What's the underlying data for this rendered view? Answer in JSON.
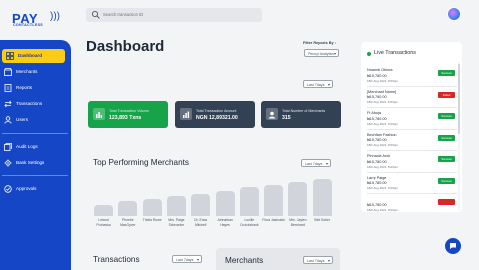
{
  "brand": {
    "name": "PAY",
    "tagline": "CONTACTLESS"
  },
  "search": {
    "placeholder": "Search transaction ID"
  },
  "sidebar": {
    "items": [
      {
        "label": "Dashboard",
        "icon": "dashboard-icon",
        "active": true
      },
      {
        "label": "Merchants",
        "icon": "merchants-icon"
      },
      {
        "label": "Reports",
        "icon": "reports-icon"
      },
      {
        "label": "Transactions",
        "icon": "transactions-icon"
      },
      {
        "label": "Users",
        "icon": "users-icon"
      },
      {
        "label": "Audit Logs",
        "icon": "audit-logs-icon"
      },
      {
        "label": "Bank Settings",
        "icon": "bank-settings-icon"
      },
      {
        "label": "Approvals",
        "icon": "approvals-icon"
      }
    ]
  },
  "main": {
    "title": "Dashboard",
    "filter": {
      "label": "Filter Reports By :",
      "value": "Pencyl Analytics"
    },
    "period_dropdown": "Last 7days",
    "stats": [
      {
        "label": "Total Transaction Volume",
        "value": "123,893 Txns",
        "color": "#16a34a",
        "icon": "volume-icon"
      },
      {
        "label": "Total Transaction Amount",
        "value": "NGN 12,89321.00",
        "color": "#334155",
        "icon": "amount-icon"
      },
      {
        "label": "Total Number of Merchants",
        "value": "315",
        "color": "#334155",
        "icon": "merchants-count-icon"
      }
    ],
    "top_merchants": {
      "title": "Top Performing Merchants",
      "dropdown": "Last 7days"
    },
    "transactions": {
      "title": "Transactions",
      "dropdown": "Last 7days"
    },
    "merchants": {
      "title": "Merchants",
      "dropdown": "Last 7days"
    }
  },
  "chart_data": {
    "type": "bar",
    "title": "Top Performing Merchants",
    "categories": [
      "Leland Prohaska",
      "Phoebe MacGyver",
      "Thelia Rowe",
      "Mrs. Paige Schroeder",
      "Dr. Erica Mitchell",
      "Johnathan Hayes",
      "Lucille Cruickshank",
      "Flora Jaskolski",
      "Mrs. Jaylen Bernhard",
      "Bell Sober"
    ],
    "values": [
      12,
      16,
      18,
      21,
      23,
      26,
      30,
      33,
      36,
      39
    ],
    "ylim": [
      0,
      42
    ],
    "grid": false,
    "color": "#d1d5db"
  },
  "live": {
    "title": "Live Transactions",
    "rows": [
      {
        "name": "Nnamdi Obiora",
        "amount": "₦15,780.00",
        "time": "18th Aug 2021, 8:00pm",
        "status": "Success",
        "color": "#16a34a"
      },
      {
        "name": "[Merchant Name]",
        "amount": "₦15,780.00",
        "time": "18th Aug 2021, 8:00pm",
        "status": "Failed",
        "color": "#dc2626"
      },
      {
        "name": "Ft Abuja",
        "amount": "₦15,780.00",
        "time": "18th Aug 2021, 8:00pm",
        "status": "Success",
        "color": "#16a34a"
      },
      {
        "name": "Bechfam Fashion",
        "amount": "₦15,780.00",
        "time": "18th Aug 2021, 8:00pm",
        "status": "Success",
        "color": "#16a34a"
      },
      {
        "name": "Pinnacle Arch",
        "amount": "₦15,780.00",
        "time": "18th Aug 2021, 8:00pm",
        "status": "Success",
        "color": "#16a34a"
      },
      {
        "name": "Larry Paige",
        "amount": "₦15,780.00",
        "time": "18th Aug 2021, 8:00pm",
        "status": "Success",
        "color": "#16a34a"
      },
      {
        "name": "",
        "amount": "₦15,780.00",
        "time": "18th Aug 2021, 8:00pm",
        "status": "",
        "color": "#dc2626"
      }
    ]
  }
}
